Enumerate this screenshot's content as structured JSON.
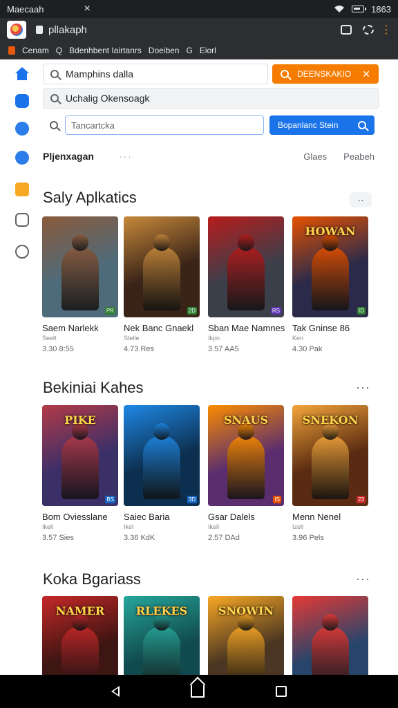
{
  "status_bar": {
    "title": "Maecaah",
    "close": "×",
    "time": "1863"
  },
  "browser": {
    "url": "pllakaph"
  },
  "bookmarks": {
    "items": [
      "Cenam",
      "Q",
      "Bdenhbent Iairtanrs",
      "Doeiben",
      "G",
      "Eiorl"
    ]
  },
  "search": {
    "row1_value": "Mamphins dalla",
    "row1_button": "DEENSKAKIO",
    "row2_value": "Uchalig Okensoagk",
    "row3_placeholder": "Tancartcka",
    "row3_button": "Bopanlanc Stein"
  },
  "tabs": {
    "first": "Pljenxagan",
    "dots": "···",
    "right": [
      "Glaes",
      "Peabeh"
    ]
  },
  "sections": [
    {
      "title": "Saly Aplkatics",
      "more": "··",
      "cards": [
        {
          "name": "Saem Narlekk",
          "sub": "Seelt",
          "price": "3.30 8:55",
          "badge": "PR",
          "bg": "#4e6b7a",
          "accent": "#8b5a3c",
          "badge_color": "#2e7d32",
          "logo": ""
        },
        {
          "name": "Nek Banc Gnaekl",
          "sub": "Stelle",
          "price": "4.73 Res",
          "badge": "2D",
          "bg": "#3a2418",
          "accent": "#c7893b",
          "badge_color": "#2e7d32",
          "logo": ""
        },
        {
          "name": "Sban Mae Namnes",
          "sub": "Ikpn",
          "price": "3.57 AA5",
          "badge": "RS",
          "bg": "#3b3f4a",
          "accent": "#b71c1c",
          "badge_color": "#5e35b1",
          "logo": ""
        },
        {
          "name": "Tak Gninse 86",
          "sub": "Ken",
          "price": "4.30 Pak",
          "badge": "ID",
          "bg": "#2b2a4a",
          "accent": "#e65100",
          "badge_color": "#2e7d32",
          "logo": "HOWAN"
        }
      ]
    },
    {
      "title": "Bekiniai Kahes",
      "more": "···",
      "cards": [
        {
          "name": "Bom Oviesslane",
          "sub": "Ikeli",
          "price": "3.57 Sies",
          "badge": "BS",
          "bg": "#3b2f68",
          "accent": "#b23a48",
          "badge_color": "#1565c0",
          "logo": "PIKE"
        },
        {
          "name": "Saiec Baria",
          "sub": "Ikel",
          "price": "3.36 KdK",
          "badge": "3D",
          "bg": "#0d2f4f",
          "accent": "#1e88e5",
          "badge_color": "#1565c0",
          "logo": ""
        },
        {
          "name": "Gsar Dalels",
          "sub": "Ikeli",
          "price": "2.57 DAd",
          "badge": "IS",
          "bg": "#5a2d6e",
          "accent": "#fb8c00",
          "badge_color": "#e65100",
          "logo": "SNAUS"
        },
        {
          "name": "Menn Nenel",
          "sub": "Izell",
          "price": "3.96 Pels",
          "badge": "23",
          "bg": "#5a2b12",
          "accent": "#f4a53a",
          "badge_color": "#c62828",
          "logo": "SNEKON"
        }
      ]
    },
    {
      "title": "Koka Bgariass",
      "more": "···",
      "cards": [
        {
          "name": "",
          "sub": "",
          "price": "",
          "badge": "",
          "bg": "#3d1512",
          "accent": "#c62828",
          "badge_color": "#c62828",
          "logo": "NAMER"
        },
        {
          "name": "",
          "sub": "",
          "price": "",
          "badge": "",
          "bg": "#114a4e",
          "accent": "#26a69a",
          "badge_color": "#26a69a",
          "logo": "RLEKES"
        },
        {
          "name": "",
          "sub": "",
          "price": "",
          "badge": "",
          "bg": "#4a3622",
          "accent": "#f9a825",
          "badge_color": "#f9a825",
          "logo": "SNOWIN"
        },
        {
          "name": "",
          "sub": "",
          "price": "",
          "badge": "",
          "bg": "#27456b",
          "accent": "#e53935",
          "badge_color": "#e53935",
          "logo": ""
        }
      ]
    }
  ]
}
